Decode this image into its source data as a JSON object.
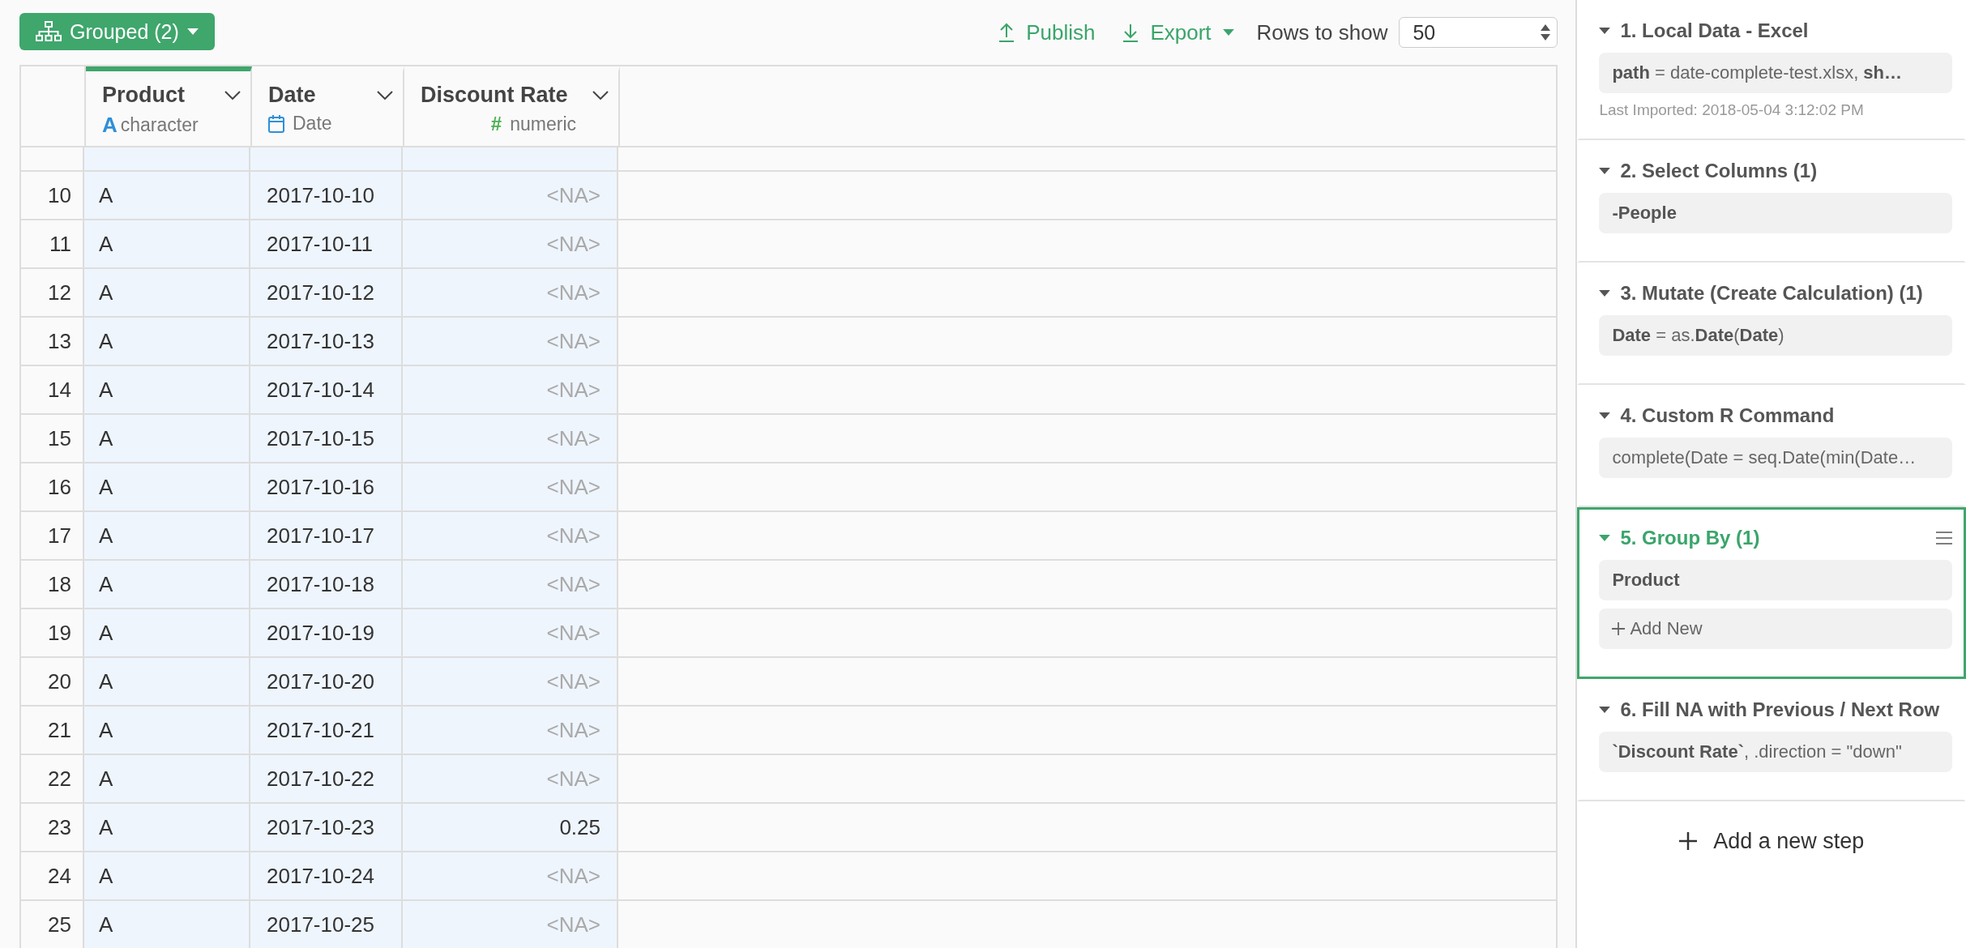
{
  "toolbar": {
    "group_button": "Grouped (2)",
    "publish": "Publish",
    "export": "Export",
    "rows_label": "Rows to show",
    "rows_value": "50"
  },
  "table": {
    "columns": [
      {
        "name": "Product",
        "kind": "character",
        "type_glyph": "A",
        "type_label": "character",
        "grouped": true
      },
      {
        "name": "Date",
        "kind": "date",
        "type_label": "Date",
        "grouped": false
      },
      {
        "name": "Discount Rate",
        "kind": "numeric",
        "type_glyph": "#",
        "type_label": "numeric",
        "grouped": false
      }
    ],
    "rows": [
      {
        "index": "10",
        "product": "A",
        "date": "2017-10-10",
        "rate": "<NA>",
        "na": true
      },
      {
        "index": "11",
        "product": "A",
        "date": "2017-10-11",
        "rate": "<NA>",
        "na": true
      },
      {
        "index": "12",
        "product": "A",
        "date": "2017-10-12",
        "rate": "<NA>",
        "na": true
      },
      {
        "index": "13",
        "product": "A",
        "date": "2017-10-13",
        "rate": "<NA>",
        "na": true
      },
      {
        "index": "14",
        "product": "A",
        "date": "2017-10-14",
        "rate": "<NA>",
        "na": true
      },
      {
        "index": "15",
        "product": "A",
        "date": "2017-10-15",
        "rate": "<NA>",
        "na": true
      },
      {
        "index": "16",
        "product": "A",
        "date": "2017-10-16",
        "rate": "<NA>",
        "na": true
      },
      {
        "index": "17",
        "product": "A",
        "date": "2017-10-17",
        "rate": "<NA>",
        "na": true
      },
      {
        "index": "18",
        "product": "A",
        "date": "2017-10-18",
        "rate": "<NA>",
        "na": true
      },
      {
        "index": "19",
        "product": "A",
        "date": "2017-10-19",
        "rate": "<NA>",
        "na": true
      },
      {
        "index": "20",
        "product": "A",
        "date": "2017-10-20",
        "rate": "<NA>",
        "na": true
      },
      {
        "index": "21",
        "product": "A",
        "date": "2017-10-21",
        "rate": "<NA>",
        "na": true
      },
      {
        "index": "22",
        "product": "A",
        "date": "2017-10-22",
        "rate": "<NA>",
        "na": true
      },
      {
        "index": "23",
        "product": "A",
        "date": "2017-10-23",
        "rate": "0.25",
        "na": false
      },
      {
        "index": "24",
        "product": "A",
        "date": "2017-10-24",
        "rate": "<NA>",
        "na": true
      },
      {
        "index": "25",
        "product": "A",
        "date": "2017-10-25",
        "rate": "<NA>",
        "na": true
      }
    ]
  },
  "steps": [
    {
      "title": "1. Local Data - Excel",
      "selected": false,
      "expanded": true,
      "chips": [
        {
          "kind": "expr",
          "text": "**path** = date-complete-test.xlsx, **sh…**"
        }
      ],
      "note": "Last Imported: 2018-05-04 3:12:02 PM"
    },
    {
      "title": "2. Select Columns (1)",
      "selected": false,
      "expanded": true,
      "chips": [
        {
          "kind": "column",
          "text": "-People"
        }
      ]
    },
    {
      "title": "3. Mutate (Create Calculation) (1)",
      "selected": false,
      "expanded": true,
      "chips": [
        {
          "kind": "expr",
          "text": "**Date** = as.**Date**(**Date**)"
        }
      ]
    },
    {
      "title": "4. Custom R Command",
      "selected": false,
      "expanded": true,
      "chips": [
        {
          "kind": "expr",
          "text": "complete(Date = seq.Date(min(Date…"
        }
      ]
    },
    {
      "title": "5. Group By (1)",
      "selected": true,
      "expanded": true,
      "chips": [
        {
          "kind": "column",
          "text": "Product"
        },
        {
          "kind": "add",
          "text": "Add New"
        }
      ]
    },
    {
      "title": "6. Fill NA with Previous / Next Row",
      "selected": false,
      "expanded": true,
      "chips": [
        {
          "kind": "expr",
          "text": "**`Discount Rate`**, .direction = \"down\""
        }
      ]
    }
  ],
  "add_step": "Add a new step"
}
